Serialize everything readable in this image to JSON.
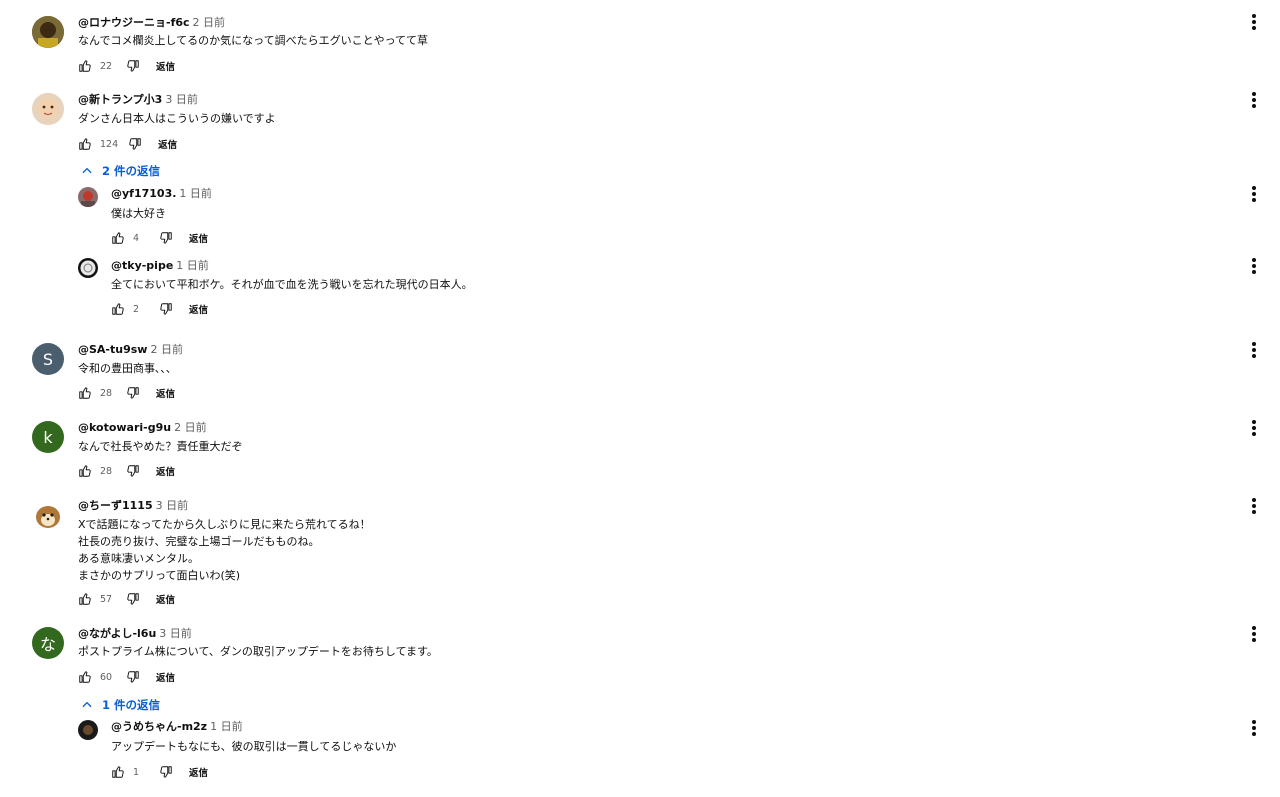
{
  "ui": {
    "reply_label": "返信"
  },
  "comments": [
    {
      "author": "@ロナウジーニョ-f6c",
      "time": "2 日前",
      "text": "なんでコメ欄炎上してるのか気になって調べたらエグいことやってて草",
      "likes": "22"
    },
    {
      "author": "@新トランプ小3",
      "time": "3 日前",
      "text": "ダンさん日本人はこういうの嫌いですよ",
      "likes": "124",
      "replies_toggle": "2 件の返信",
      "replies": [
        {
          "author": "@yf17103.",
          "time": "1 日前",
          "text": "僕は大好き",
          "likes": "4"
        },
        {
          "author": "@tky-pipe",
          "time": "1 日前",
          "text": "全てにおいて平和ボケ。それが血で血を洗う戦いを忘れた現代の日本人。",
          "likes": "2"
        }
      ]
    },
    {
      "author": "@SA-tu9sw",
      "time": "2 日前",
      "text": "令和の豊田商事､､､",
      "likes": "28",
      "avatar_letter": "S",
      "avatar_color": "#4a5e6e"
    },
    {
      "author": "@kotowari-g9u",
      "time": "2 日前",
      "text": "なんで社長やめた？責任重大だぞ",
      "likes": "28",
      "avatar_letter": "k",
      "avatar_color": "#33691e"
    },
    {
      "author": "@ちーず1115",
      "time": "3 日前",
      "text": "Xで話題になってたから久しぶりに見に来たら荒れてるね！\n社長の売り抜け、完璧な上場ゴールだもものね。\nある意味凄いメンタル。\nまさかのサプリって面白いわ(笑)",
      "likes": "57"
    },
    {
      "author": "@ながよし-l6u",
      "time": "3 日前",
      "text": "ポストプライム株について、ダンの取引アップデートをお待ちしてます。",
      "likes": "60",
      "avatar_letter": "な",
      "avatar_color": "#33691e",
      "replies_toggle": "1 件の返信",
      "replies": [
        {
          "author": "@うめちゃん-m2z",
          "time": "1 日前",
          "text": "アップデートもなにも、彼の取引は一貫してるじゃないか",
          "likes": "1"
        }
      ]
    }
  ],
  "colors": {
    "link": "#065fd4",
    "secondary": "#606060"
  },
  "icons": [
    "like-icon",
    "dislike-icon",
    "more-vert-icon",
    "chevron-up-icon"
  ]
}
